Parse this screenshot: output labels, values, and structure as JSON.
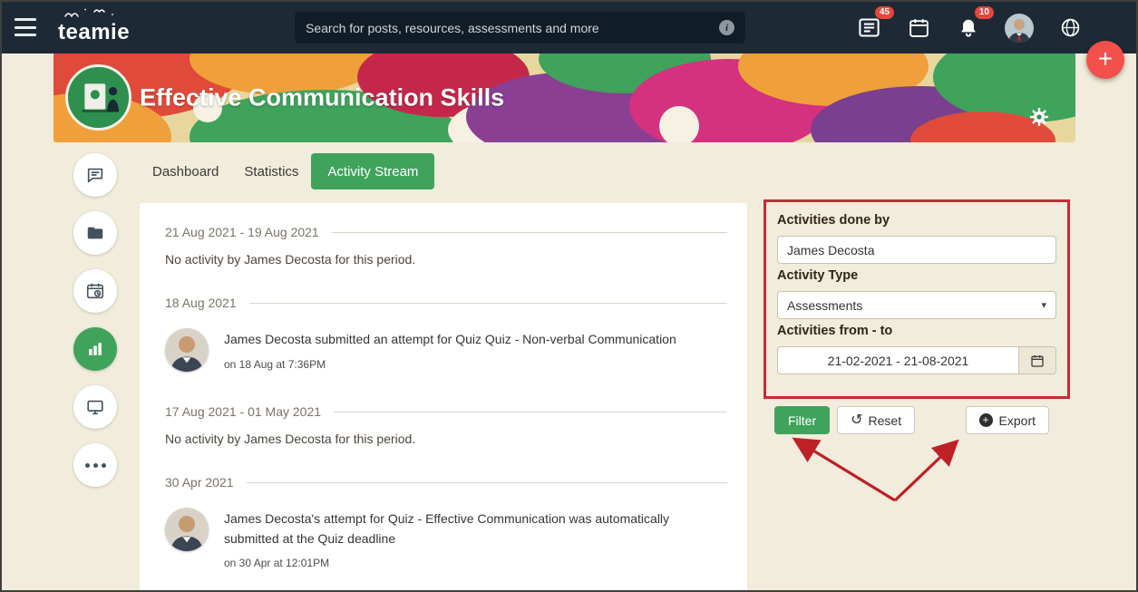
{
  "colors": {
    "accent_green": "#3fa35c",
    "navbar_bg": "#1d2935",
    "page_bg": "#f1ecdb",
    "annotation_red": "#c92a35",
    "fab_red": "#f4504b",
    "badge_red": "#e8453c"
  },
  "icons": {
    "info": "i",
    "plus": "+",
    "reset": "↺",
    "caret": "▾"
  },
  "brand": {
    "name": "teamie"
  },
  "navbar": {
    "search_placeholder": "Search for posts, resources, assessments and more",
    "posts_badge": "45",
    "alerts_badge": "10"
  },
  "banner": {
    "title": "Effective Communication Skills"
  },
  "tabs": {
    "dashboard": "Dashboard",
    "statistics": "Statistics",
    "activity_stream": "Activity Stream"
  },
  "stream": {
    "groups": [
      {
        "date": "21 Aug 2021 - 19 Aug 2021",
        "message": "No activity by James Decosta for this period."
      },
      {
        "date": "18 Aug 2021",
        "text": "James Decosta submitted an attempt for Quiz Quiz - Non-verbal Communication",
        "time": "on 18 Aug at 7:36PM"
      },
      {
        "date": "17 Aug 2021 - 01 May 2021",
        "message": "No activity by James Decosta for this period."
      },
      {
        "date": "30 Apr 2021",
        "text": "James Decosta's attempt for Quiz - Effective Communication was automatically submitted at the Quiz deadline",
        "time": "on 30 Apr at 12:01PM"
      }
    ]
  },
  "filters": {
    "done_by_label": "Activities done by",
    "done_by_value": "James Decosta",
    "type_label": "Activity Type",
    "type_value": "Assessments",
    "range_label": "Activities from - to",
    "range_value": "21-02-2021 - 21-08-2021",
    "filter_button": "Filter",
    "reset_button": "Reset",
    "export_button": "Export"
  }
}
